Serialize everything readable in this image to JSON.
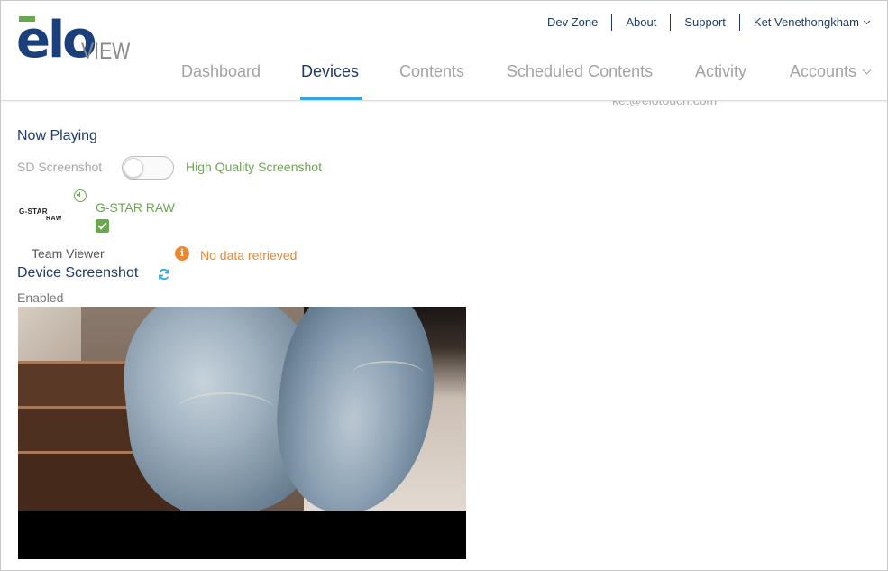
{
  "brand": {
    "logo_main": "elo",
    "logo_sub": "VIEW"
  },
  "utility_nav": {
    "items": [
      "Dev Zone",
      "About",
      "Support"
    ],
    "user_name": "Ket Venethongkham"
  },
  "main_nav": {
    "items": [
      {
        "label": "Dashboard",
        "active": false
      },
      {
        "label": "Devices",
        "active": true
      },
      {
        "label": "Contents",
        "active": false
      },
      {
        "label": "Scheduled Contents",
        "active": false
      },
      {
        "label": "Activity",
        "active": false
      },
      {
        "label": "Accounts",
        "active": false
      }
    ],
    "active_color": "#1f3b66",
    "underline_color": "#2fa8e0"
  },
  "ghost_email": "ket@elotouch.com",
  "now_playing": {
    "heading": "Now Playing",
    "sd_label": "SD Screenshot",
    "hq_label": "High Quality Screenshot",
    "toggle_on": false,
    "brand_logo_line1": "G-STAR",
    "brand_logo_line2": "RAW",
    "program_name": "G-STAR RAW",
    "status_icon": "clock-icon",
    "check_icon": "check-icon"
  },
  "team_viewer": {
    "label": "Team Viewer",
    "status": "No data retrieved",
    "status_icon": "info-icon",
    "status_color": "#f0862e"
  },
  "device_screenshot": {
    "heading": "Device Screenshot",
    "refresh_icon": "refresh-icon",
    "state": "Enabled"
  }
}
